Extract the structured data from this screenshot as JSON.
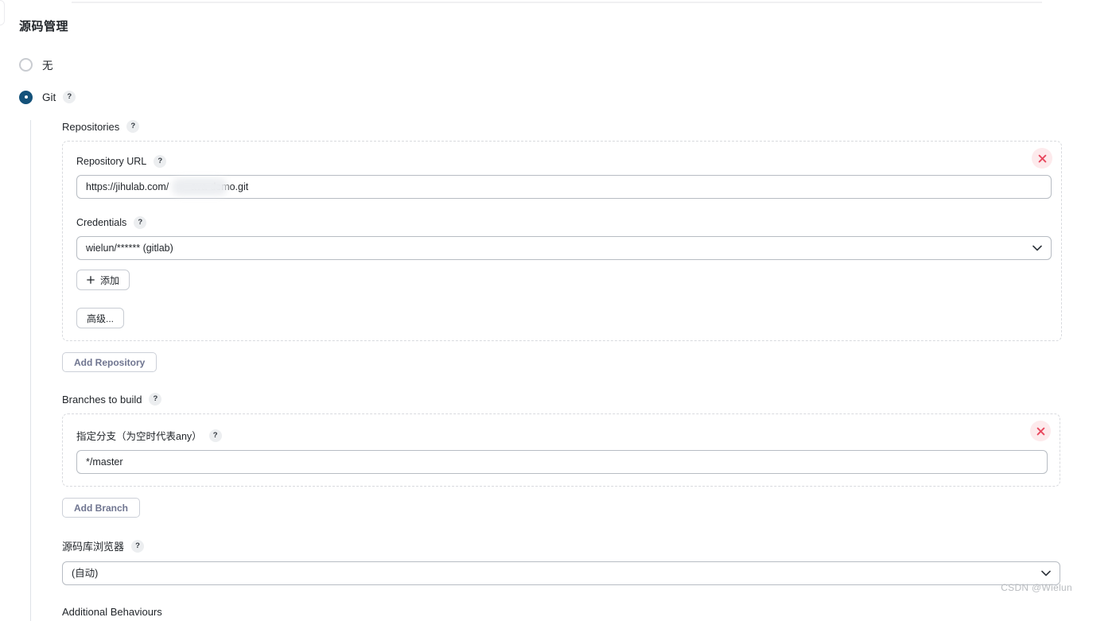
{
  "page": {
    "title": "源码管理",
    "watermark": "CSDN @Wielun"
  },
  "scm_options": [
    {
      "label": "无",
      "selected": false
    },
    {
      "label": "Git",
      "selected": true,
      "help": "?"
    }
  ],
  "git": {
    "repositories": {
      "label": "Repositories",
      "help": "?",
      "entries": [
        {
          "url_label": "Repository URL",
          "url_help": "?",
          "url_value": "https://jihulab.com/        ava-demo.git",
          "credentials_label": "Credentials",
          "credentials_help": "?",
          "credentials_value": "wielun/****** (gitlab)",
          "add_credentials_label": "添加",
          "add_credentials_icon": "plus-icon",
          "advanced_label": "高级...",
          "delete_icon": "close-icon"
        }
      ],
      "add_repository_label": "Add Repository"
    },
    "branches": {
      "label": "Branches to build",
      "help": "?",
      "entries": [
        {
          "name_label": "指定分支（为空时代表any）",
          "name_help": "?",
          "name_value": "*/master",
          "delete_icon": "close-icon"
        }
      ],
      "add_branch_label": "Add Branch"
    },
    "repository_browser": {
      "label": "源码库浏览器",
      "help": "?",
      "value": "(自动)"
    },
    "additional_behaviours": {
      "label": "Additional Behaviours"
    }
  },
  "colors": {
    "accent": "#14527a",
    "delete_bg": "#fdeaec",
    "delete_fg": "#e8495f",
    "repeat_btn_text": "#6f7590"
  }
}
